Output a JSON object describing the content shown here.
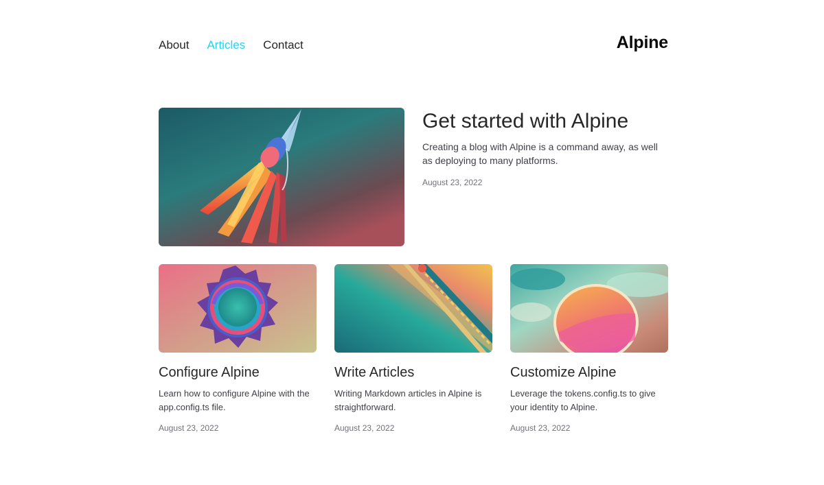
{
  "nav": {
    "items": [
      {
        "label": "About"
      },
      {
        "label": "Articles",
        "active": true
      },
      {
        "label": "Contact"
      }
    ],
    "brand": "Alpine"
  },
  "featured": {
    "title": "Get started with Alpine",
    "description": "Creating a blog with Alpine is a command away, as well as deploying to many platforms.",
    "date": "August 23, 2022",
    "image": "rocket-illustration"
  },
  "articles": [
    {
      "title": "Configure Alpine",
      "description": "Learn how to configure Alpine with the app.config.ts file.",
      "date": "August 23, 2022",
      "image": "gear-ring-illustration"
    },
    {
      "title": "Write Articles",
      "description": "Writing Markdown articles in Alpine is straightforward.",
      "date": "August 23, 2022",
      "image": "pencil-illustration"
    },
    {
      "title": "Customize Alpine",
      "description": "Leverage the tokens.config.ts to give your identity to Alpine.",
      "date": "August 23, 2022",
      "image": "palette-illustration"
    }
  ],
  "colors": {
    "accent": "#22d3ee",
    "text": "#27272a",
    "muted": "#71717a"
  }
}
